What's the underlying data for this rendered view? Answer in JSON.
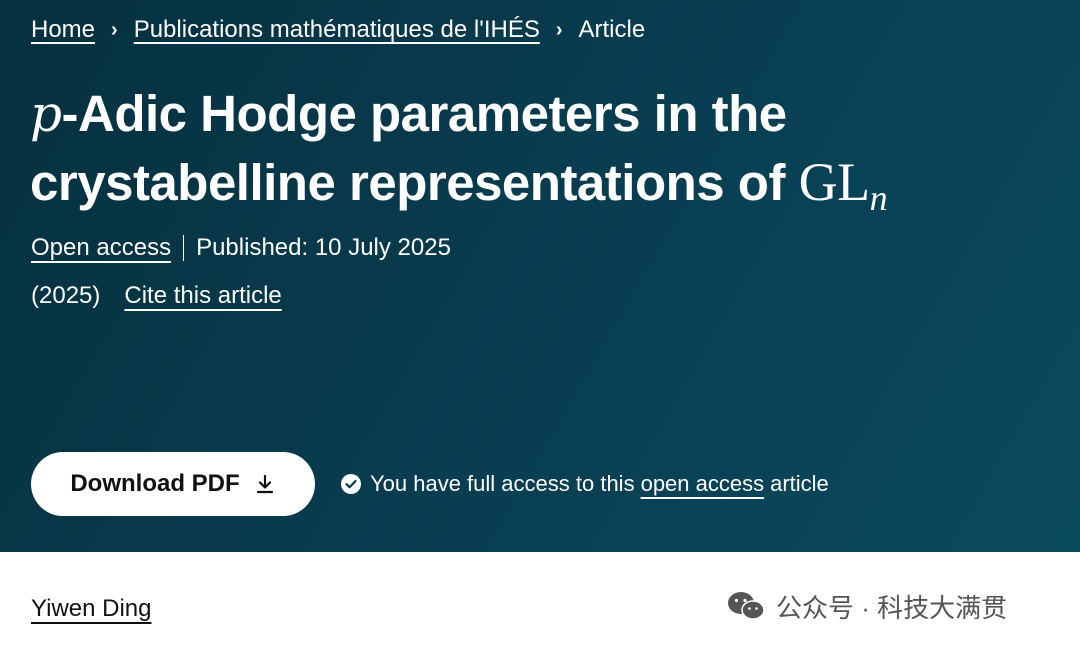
{
  "breadcrumb": {
    "home": "Home",
    "journal": "Publications mathématiques de l'IHÉS",
    "current": "Article",
    "separator": "›"
  },
  "article": {
    "title_math_prefix": "p",
    "title_line1_text": "-Adic Hodge parameters in the",
    "title_line2_text": "crystabelline representations of ",
    "title_math_group": "GL",
    "title_math_sub": "n",
    "open_access_label": "Open access",
    "published": "Published: 10 July 2025",
    "year": "(2025)",
    "cite_label": "Cite this article"
  },
  "actions": {
    "download_label": "Download PDF",
    "download_icon": "download-icon"
  },
  "access": {
    "prefix": "You have full access to this",
    "link": "open access",
    "suffix": "article",
    "icon": "check-circle-icon"
  },
  "author": {
    "name": "Yiwen Ding"
  },
  "watermark": {
    "text": "公众号 · 科技大满贯",
    "icon": "wechat-icon"
  },
  "colors": {
    "hero_bg": "#093e52",
    "hero_text": "#ffffff",
    "button_bg": "#ffffff",
    "button_text": "#111111"
  }
}
